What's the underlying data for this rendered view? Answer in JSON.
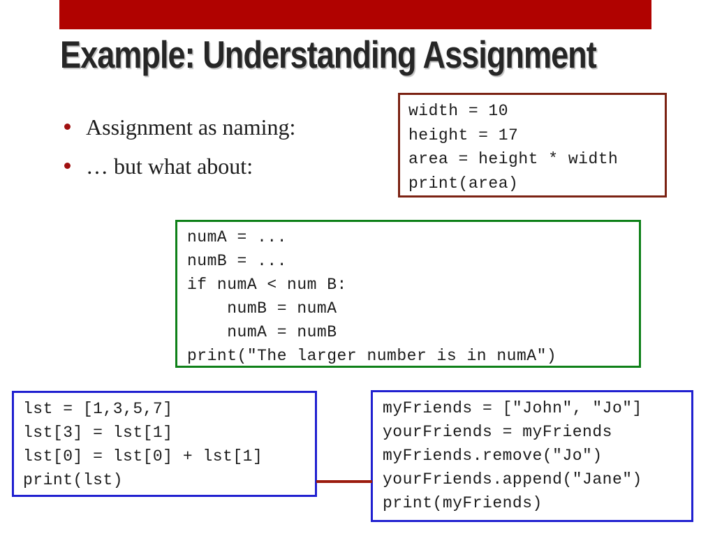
{
  "slide": {
    "title": "Example: Understanding Assignment",
    "header_bar_color": "#b00200",
    "title_color": "#262626",
    "background_color": "#ffffff"
  },
  "bullets": [
    {
      "text": "Assignment as naming:",
      "marker_color": "#a01010"
    },
    {
      "text": "… but what about:",
      "marker_color": "#a01010"
    }
  ],
  "code_blocks": {
    "red_box": {
      "border_color": "#7b2213",
      "code": "width = 10\nheight = 17\narea = height * width\nprint(area)"
    },
    "green_box": {
      "border_color": "#0e8018",
      "code": "numA = ...\nnumB = ...\nif numA < num B:\n    numB = numA\n    numA = numB\nprint(\"The larger number is in numA\")"
    },
    "blue_box_left": {
      "border_color": "#2020d0",
      "code": "lst = [1,3,5,7]\nlst[3] = lst[1]\nlst[0] = lst[0] + lst[1]\nprint(lst)"
    },
    "blue_box_right": {
      "border_color": "#2020d0",
      "code": "myFriends = [\"John\", \"Jo\"]\nyourFriends = myFriends\nmyFriends.remove(\"Jo\")\nyourFriends.append(\"Jane\")\nprint(myFriends)"
    }
  },
  "connector": {
    "color": "#9b1b0e",
    "from": "blue_box_left",
    "to": "blue_box_right"
  }
}
